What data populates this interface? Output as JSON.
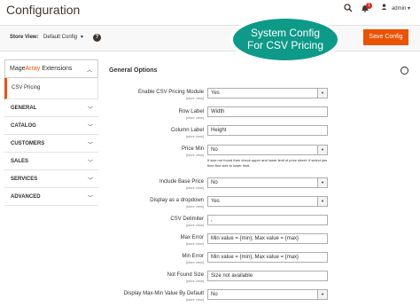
{
  "header": {
    "title": "Configuration",
    "notification_count": "1",
    "user_name": "admin",
    "user_caret": "▾"
  },
  "toolbar": {
    "store_view_label": "Store View:",
    "store_view_value": "Default Config",
    "help_icon_text": "?",
    "save_label": "Save Config"
  },
  "callout": {
    "line1": "System Config",
    "line2": "For CSV Pricing"
  },
  "sidebar": {
    "brand_mage": "Mage",
    "brand_array": "Array",
    "brand_suffix": " Extensions",
    "active_item": "CSV Pricing",
    "items": [
      "GENERAL",
      "CATALOG",
      "CUSTOMERS",
      "SALES",
      "SERVICES",
      "ADVANCED"
    ]
  },
  "section": {
    "title": "General Options",
    "toggle_glyph": "⌃"
  },
  "fields": [
    {
      "label": "Enable CSV Pricing Module",
      "scope": "[store view]",
      "value": "Yes",
      "type": "select"
    },
    {
      "label": "Row Label",
      "scope": "[store view]",
      "value": "Width",
      "type": "text"
    },
    {
      "label": "Column Label",
      "scope": "[store view]",
      "value": "Height",
      "type": "text"
    },
    {
      "label": "Price Min",
      "scope": "[store view]",
      "value": "No",
      "type": "select"
    },
    {
      "label": "Include Base Price",
      "scope": "[store view]",
      "value": "No",
      "type": "select"
    },
    {
      "label": "Display as a dropdown",
      "scope": "[store view]",
      "value": "Yes",
      "type": "select"
    },
    {
      "label": "CSV Delimiter",
      "scope": "[store view]",
      "value": ",",
      "type": "text"
    },
    {
      "label": "Max Error",
      "scope": "[store view]",
      "value": "Min value = {min}, Max value = {max}",
      "type": "text"
    },
    {
      "label": "Min Error",
      "scope": "[store view]",
      "value": "Min value = {min}, Max value = {max}",
      "type": "text"
    },
    {
      "label": "Not Found Size",
      "scope": "[store view]",
      "value": "Size not available",
      "type": "text"
    },
    {
      "label": "Display Max-Min Value By Default",
      "scope": "[store view]",
      "value": "No",
      "type": "select"
    }
  ],
  "price_min_note": "If size not found then check upper and lower limit of price sheet. If select yes then find size to lower limit.",
  "colors": {
    "accent": "#eb5202",
    "callout": "#0e9a88",
    "badge": "#e22626"
  },
  "icons": {
    "search": "search-icon",
    "bell": "bell-icon",
    "user": "user-icon",
    "help": "help-icon",
    "chevron": "chevron-down-icon"
  }
}
